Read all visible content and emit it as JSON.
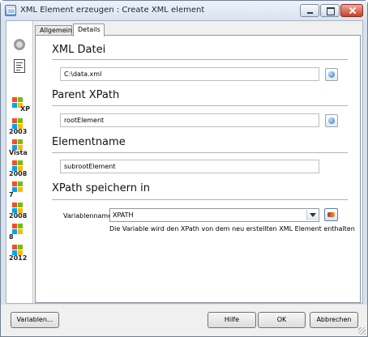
{
  "window": {
    "title": "XML Element erzeugen : Create XML element"
  },
  "sidebar": {
    "os_items": [
      {
        "label": "XP",
        "colors": [
          "#f25022",
          "#7fba00",
          "#00a4ef",
          "#ffb900"
        ]
      },
      {
        "label": "2003",
        "colors": [
          "#f25022",
          "#7fba00",
          "#00a4ef",
          "#ffb900"
        ]
      },
      {
        "label": "Vista",
        "colors": [
          "#f25022",
          "#7fba00",
          "#00a4ef",
          "#ffb900"
        ]
      },
      {
        "label": "2008",
        "colors": [
          "#f25022",
          "#7fba00",
          "#00a4ef",
          "#ffb900"
        ]
      },
      {
        "label": "7",
        "colors": [
          "#f25022",
          "#7fba00",
          "#00a4ef",
          "#ffb900"
        ]
      },
      {
        "label": "2008",
        "colors": [
          "#f25022",
          "#7fba00",
          "#00a4ef",
          "#ffb900"
        ]
      },
      {
        "label": "8",
        "colors": [
          "#f25022",
          "#7fba00",
          "#00a4ef",
          "#ffb900"
        ]
      },
      {
        "label": "2012",
        "colors": [
          "#f25022",
          "#7fba00",
          "#00a4ef",
          "#ffb900"
        ]
      }
    ]
  },
  "tabs": [
    {
      "label": "Allgemein",
      "active": false
    },
    {
      "label": "Details",
      "active": true
    }
  ],
  "sections": {
    "xml_file": {
      "title": "XML Datei",
      "value": "C:\\data.xml"
    },
    "parent_xpath": {
      "title": "Parent XPath",
      "value": "rootElement"
    },
    "element_name": {
      "title": "Elementname",
      "value": "subrootElement"
    },
    "save_xpath": {
      "title": "XPath speichern in",
      "variable_label": "Variablenname",
      "variable_value": "XPATH",
      "hint": "Die Variable wird den XPath von dem neu erstellten XML Element enthalten"
    }
  },
  "footer": {
    "variables_label": "Variablen...",
    "help_label": "Hilfe",
    "ok_label": "OK",
    "cancel_label": "Abbrechen"
  },
  "icons": {
    "app": "xml-app-icon",
    "general": "circle-icon",
    "details": "document-icon",
    "browse": "browse-icon",
    "variables": "variables-icon"
  }
}
